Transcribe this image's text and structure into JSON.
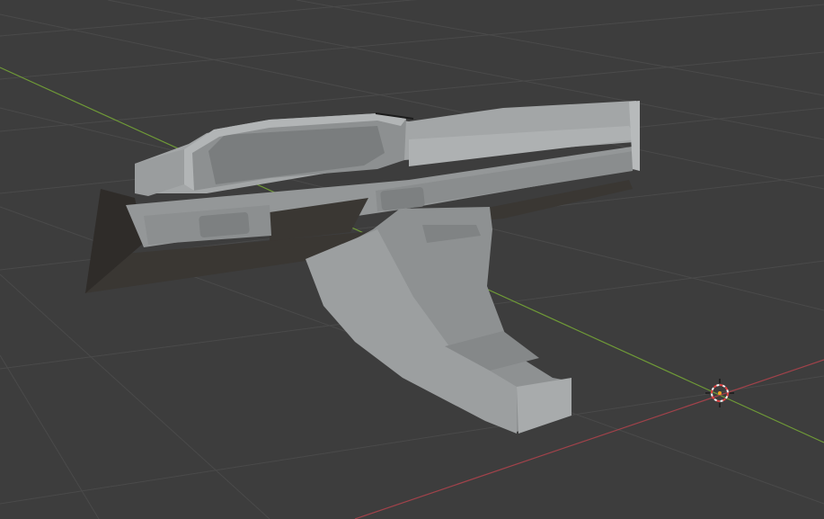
{
  "viewport": {
    "mode": "3d-viewport",
    "shading": "solid",
    "show_floor_grid": true,
    "show_axes": [
      "x",
      "y"
    ],
    "colors": {
      "background": "#3d3d3d",
      "grid_line": "#4b4b4b",
      "x_axis": "#a0424a",
      "y_axis": "#6f9a37",
      "mesh_light": "#a9acad",
      "mesh_mid": "#8e9192",
      "mesh_dark": "#6c6f70",
      "mesh_shadow": "#3a3733",
      "cursor_ring_red": "#e24444",
      "cursor_ring_white": "#f2f2f2",
      "origin_dot": "#f0a020"
    }
  },
  "scene": {
    "object": {
      "kind": "mesh",
      "description_icon": "mesh-icon"
    },
    "cursor": {
      "icon": "3d-cursor-icon"
    }
  }
}
